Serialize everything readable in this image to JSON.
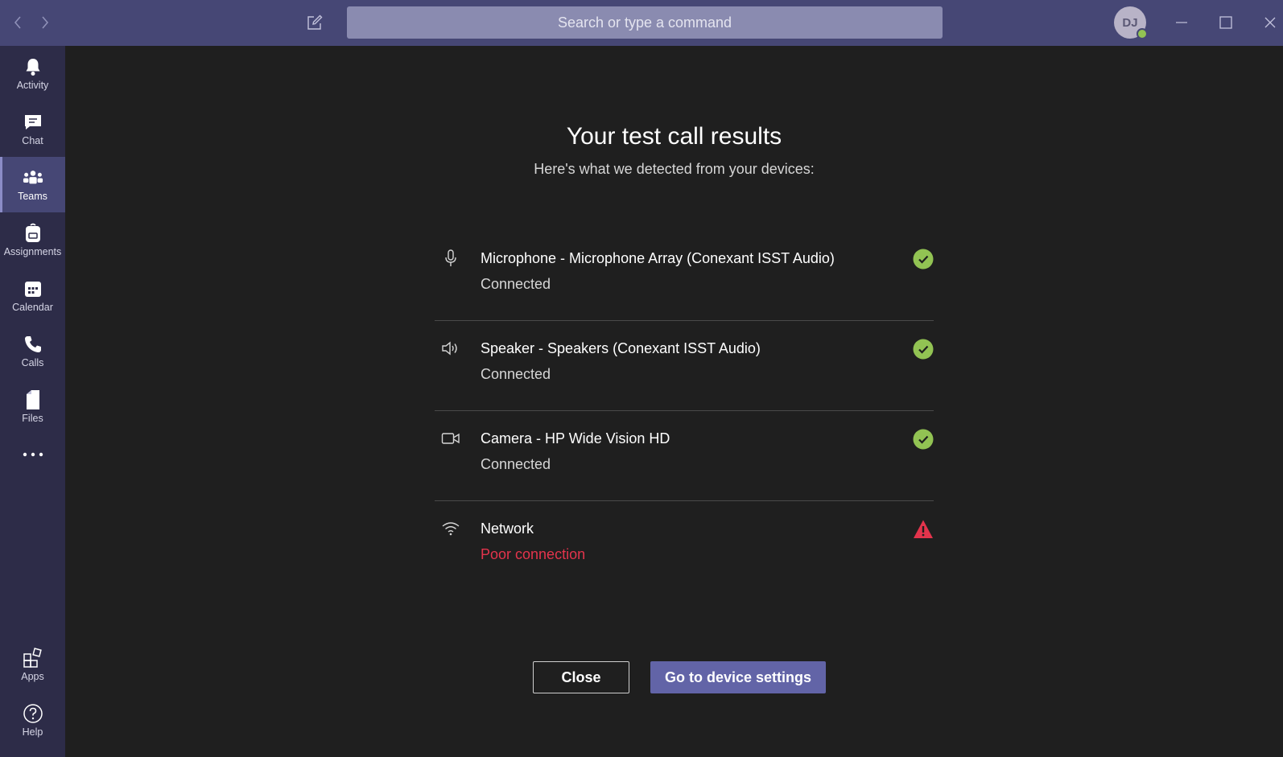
{
  "titlebar": {
    "search_placeholder": "Search or type a command",
    "avatar_initials": "DJ"
  },
  "rail": {
    "items": [
      {
        "label": "Activity",
        "icon": "bell-icon"
      },
      {
        "label": "Chat",
        "icon": "chat-icon"
      },
      {
        "label": "Teams",
        "icon": "teams-icon",
        "active": true
      },
      {
        "label": "Assignments",
        "icon": "backpack-icon"
      },
      {
        "label": "Calendar",
        "icon": "calendar-icon"
      },
      {
        "label": "Calls",
        "icon": "phone-icon"
      },
      {
        "label": "Files",
        "icon": "file-icon"
      }
    ],
    "more_icon": "ellipsis-icon",
    "bottom": [
      {
        "label": "Apps",
        "icon": "apps-icon"
      },
      {
        "label": "Help",
        "icon": "help-icon"
      }
    ]
  },
  "main": {
    "title": "Your test call results",
    "subtitle": "Here's what we detected from your devices:",
    "devices": [
      {
        "name": "Microphone - Microphone Array (Conexant ISST Audio)",
        "status": "Connected",
        "icon": "microphone-icon",
        "state": "ok"
      },
      {
        "name": "Speaker - Speakers (Conexant ISST Audio)",
        "status": "Connected",
        "icon": "speaker-icon",
        "state": "ok"
      },
      {
        "name": "Camera - HP Wide Vision HD",
        "status": "Connected",
        "icon": "camera-icon",
        "state": "ok"
      },
      {
        "name": "Network",
        "status": "Poor connection",
        "icon": "wifi-icon",
        "state": "warning"
      }
    ],
    "close_label": "Close",
    "settings_label": "Go to device settings"
  },
  "colors": {
    "titlebar": "#464775",
    "rail": "#2d2c48",
    "background": "#1f1f1f",
    "accent": "#6264a7",
    "ok": "#92c353",
    "error": "#e3344c"
  }
}
